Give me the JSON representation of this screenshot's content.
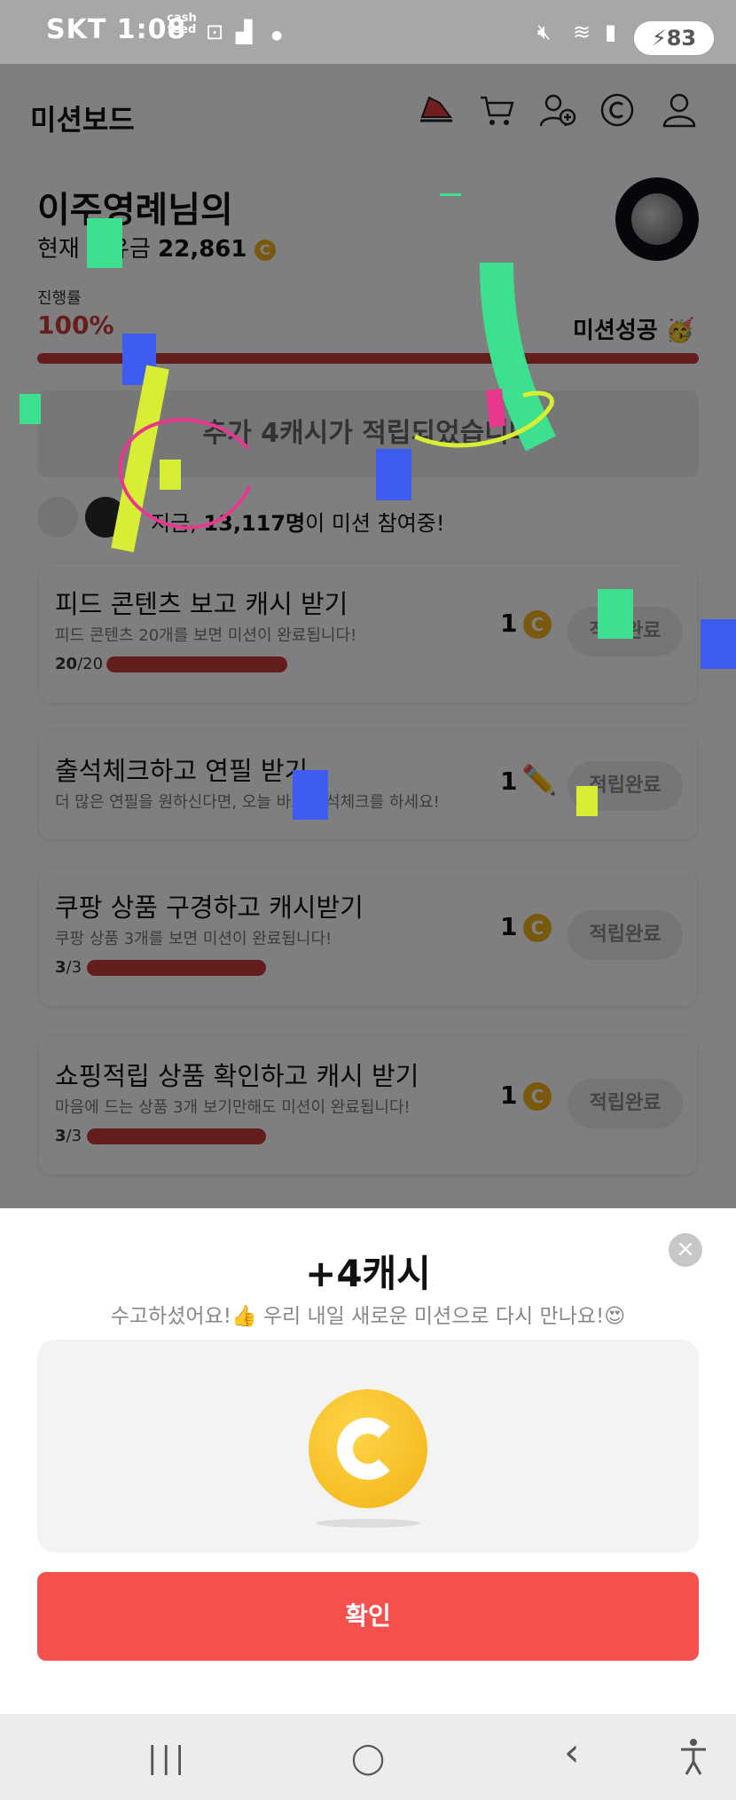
{
  "status_bar": {
    "carrier_time": "SKT 1:08",
    "brand": "cash feed",
    "battery": "83"
  },
  "header": {
    "title": "미션보드",
    "icons": [
      "shoe-icon",
      "cart-icon",
      "add-user-icon",
      "coin-icon",
      "profile-icon"
    ]
  },
  "summary": {
    "user_name": "이주영례님의",
    "held_label": "현재 보유금",
    "held_amount": "22,861",
    "coin_symbol": "C"
  },
  "progress": {
    "label": "진행률",
    "value": "100%",
    "success_text": "미션성공 🥳",
    "fraction": 1.0
  },
  "bonus_banner": "추가 4캐시가 적립되었습니다",
  "participants": {
    "prefix": "지금, ",
    "count": "13,117명",
    "suffix": "이 미션 참여중!"
  },
  "missions": [
    {
      "title": "피드 콘텐츠 보고 캐시 받기",
      "desc": "피드 콘텐츠 20개를 보면 미션이 완료됩니다!",
      "done": "20",
      "total": "/20",
      "reward": "1",
      "reward_type": "coin",
      "button": "적립완료"
    },
    {
      "title": "출석체크하고 연필 받기",
      "desc": "더 많은 연필을 원하신다면, 오늘 바로 출석체크를 하세요!",
      "reward": "1",
      "reward_type": "pencil",
      "button": "적립완료"
    },
    {
      "title": "쿠팡 상품 구경하고 캐시받기",
      "desc": "쿠팡 상품 3개를 보면 미션이 완료됩니다!",
      "done": "3",
      "total": "/3",
      "reward": "1",
      "reward_type": "coin",
      "button": "적립완료"
    },
    {
      "title": "쇼핑적립 상품 확인하고 캐시 받기",
      "desc": "마음에 드는 상품 3개 보기만해도 미션이 완료됩니다!",
      "done": "3",
      "total": "/3",
      "reward": "1",
      "reward_type": "coin",
      "button": "적립완료"
    }
  ],
  "modal": {
    "title": "+4캐시",
    "subtitle": "수고하셨어요!👍 우리 내일 새로운 미션으로 다시 만나요!😍",
    "confirm": "확인",
    "close": "×"
  },
  "nav": {
    "recent": "|||",
    "home": "◯",
    "back": "‹"
  },
  "colors": {
    "accent_red": "#f4504e",
    "progress_red": "#c83a3a",
    "coin_gold": "#f0b21a"
  }
}
